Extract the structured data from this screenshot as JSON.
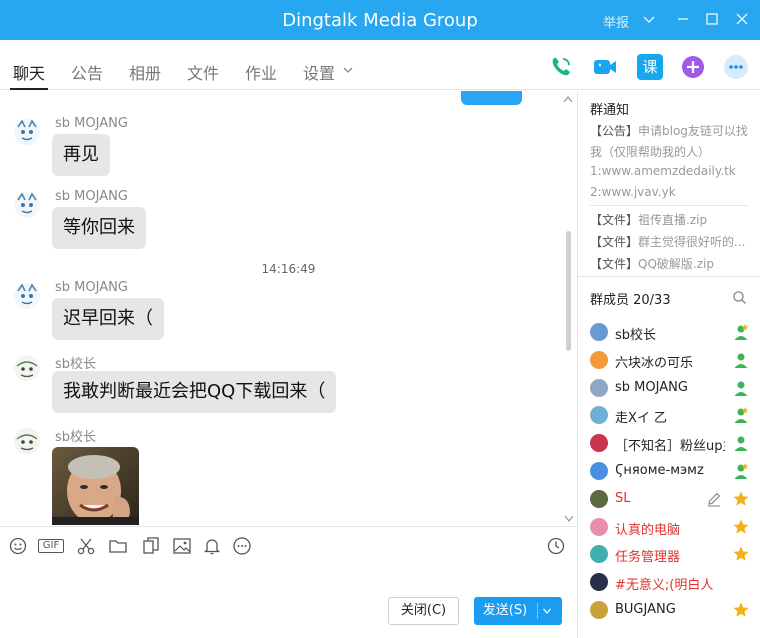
{
  "window": {
    "title": "Dingtalk Media Group",
    "report_label": "举报"
  },
  "tabs": [
    {
      "label": "聊天",
      "active": true
    },
    {
      "label": "公告"
    },
    {
      "label": "相册"
    },
    {
      "label": "文件"
    },
    {
      "label": "作业"
    },
    {
      "label": "设置"
    }
  ],
  "actions": {
    "phone": "phone-icon",
    "video": "video-camera-icon",
    "class": "课",
    "add": "plus-icon",
    "more": "more-icon"
  },
  "messages": [
    {
      "sender": "sb MOJANG",
      "text": "再见"
    },
    {
      "sender": "sb MOJANG",
      "text": "等你回来"
    },
    {
      "timestamp": "14:16:49"
    },
    {
      "sender": "sb MOJANG",
      "text": "迟早回来（"
    },
    {
      "sender": "sb校长",
      "text": "我敢判断最近会把QQ下载回来（"
    },
    {
      "sender": "sb校长",
      "image": "photo"
    }
  ],
  "toolbar_icons": [
    "emoji-icon",
    "gif-icon",
    "scissors-icon",
    "folder-icon",
    "files-icon",
    "image-icon",
    "bell-icon",
    "more-circle-icon",
    "history-clock-icon"
  ],
  "toolbar": {
    "gif_label": "GIF"
  },
  "buttons": {
    "close": "关闭(C)",
    "send": "发送(S)"
  },
  "side": {
    "notice_title": "群通知",
    "notices": [
      {
        "tag": "【公告】",
        "text": "申请blog友链可以找"
      },
      {
        "tag": "",
        "text": "我（仅限帮助我的人）"
      },
      {
        "tag": "",
        "text": "1:www.amemzdedaily.tk"
      },
      {
        "tag": "",
        "text": "2:www.jvav.yk"
      },
      {
        "tag": "【文件】",
        "text": "祖传直播.zip"
      },
      {
        "tag": "【文件】",
        "text": "群主觉得很好听的..."
      },
      {
        "tag": "【文件】",
        "text": "QQ破解版.zip"
      }
    ],
    "members_title": "群成员 20/33",
    "members": [
      {
        "name": "sb校长",
        "red": false,
        "role": "admin"
      },
      {
        "name": "六块冰の可乐",
        "red": false,
        "role": "member"
      },
      {
        "name": "sb MOJANG",
        "red": false,
        "role": "member"
      },
      {
        "name": "走Xイ 乙",
        "red": false,
        "role": "admin"
      },
      {
        "name": "［不知名］粉丝up主",
        "red": false,
        "role": "member"
      },
      {
        "name": "Ϛняоме-мэмz",
        "red": false,
        "role": "admin"
      },
      {
        "name": "SL",
        "red": true,
        "role": "star"
      },
      {
        "name": "认真的电脑",
        "red": true,
        "role": "star"
      },
      {
        "name": "任务管理器",
        "red": true,
        "role": "star"
      },
      {
        "name": "#无意义;(明白人",
        "red": true,
        "role": "none"
      },
      {
        "name": "BUGJANG",
        "red": false,
        "role": "star"
      }
    ]
  },
  "colors": {
    "accent": "#27a7f0",
    "send": "#1a9cf0",
    "red": "#e0332e",
    "green": "#3cb45a",
    "gold": "#f2b318"
  }
}
